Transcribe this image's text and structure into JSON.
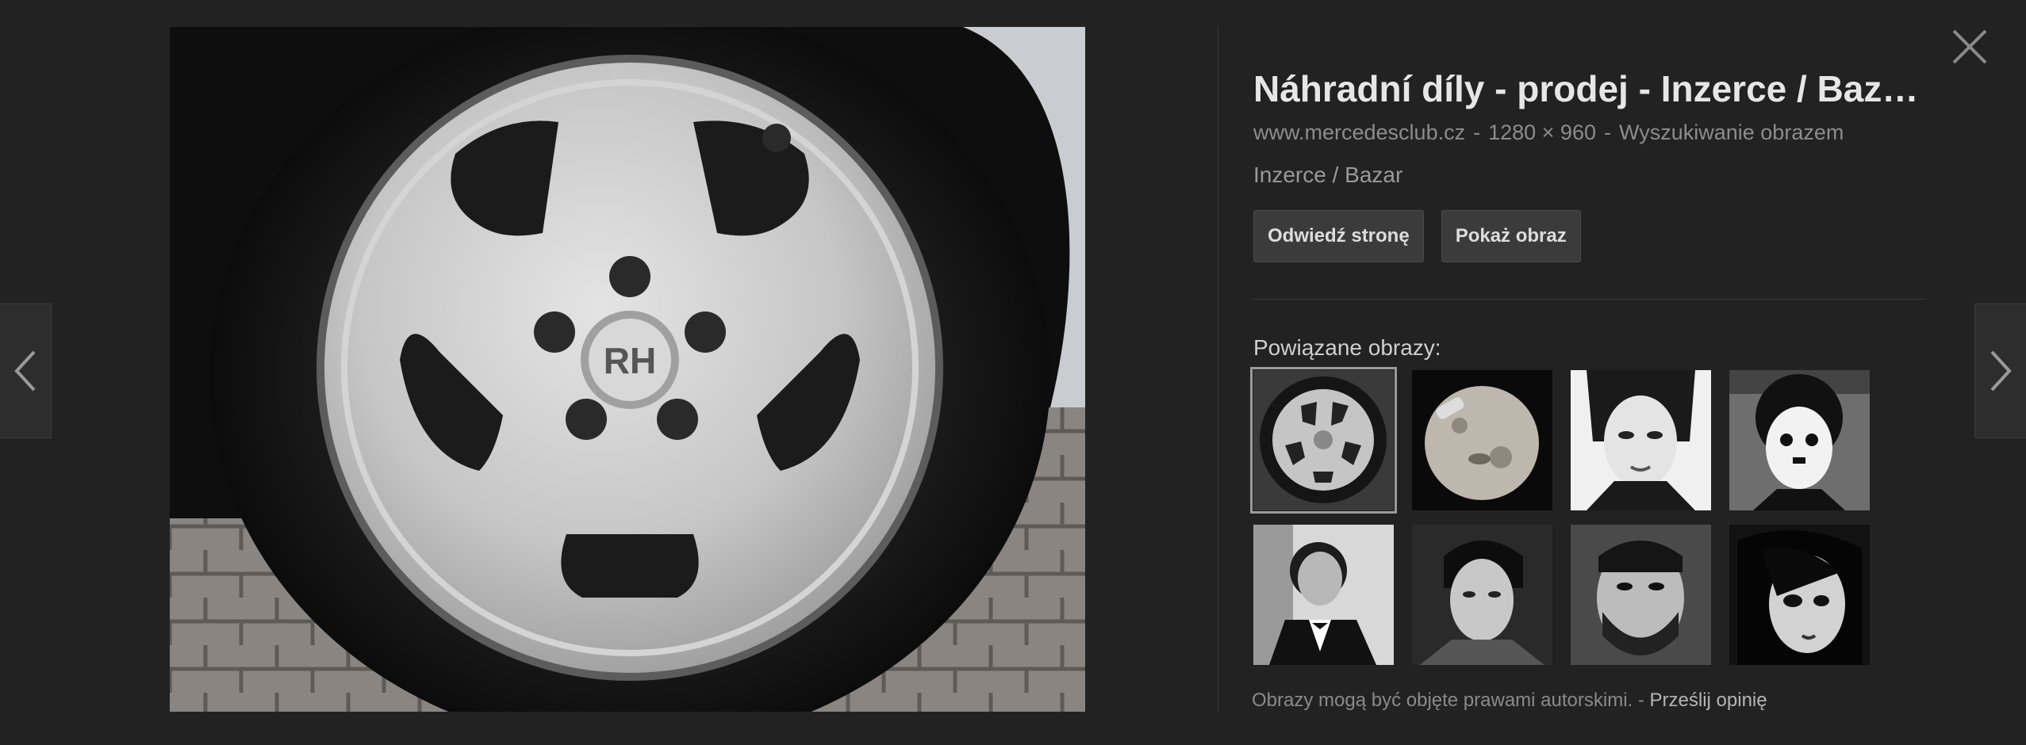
{
  "viewer": {
    "title": "Náhradní díly - prodej - Inzerce / Baz…",
    "source_domain": "www.mercedesclub.cz",
    "dimensions": "1280 × 960",
    "search_by_image": "Wyszukiwanie obrazem",
    "separator": "-",
    "subtitle": "Inzerce / Bazar",
    "visit_button": "Odwiedź stronę",
    "view_button": "Pokaż obraz",
    "related_label": "Powiązane obrazy:",
    "footer_text": "Obrazy mogą być objęte prawami autorskimi.",
    "footer_sep": "-",
    "feedback_link": "Prześlij opinię",
    "hub_badge": "RH"
  },
  "related_images": [
    {
      "name": "related-thumb-wheel",
      "selected": true
    },
    {
      "name": "related-thumb-moon",
      "selected": false
    },
    {
      "name": "related-thumb-woman-portrait",
      "selected": false
    },
    {
      "name": "related-thumb-clown-portrait",
      "selected": false
    },
    {
      "name": "related-thumb-man-tuxedo",
      "selected": false
    },
    {
      "name": "related-thumb-young-man",
      "selected": false
    },
    {
      "name": "related-thumb-bearded-man",
      "selected": false
    },
    {
      "name": "related-thumb-goth-girl",
      "selected": false
    }
  ],
  "icons": {
    "prev": "chevron-left-icon",
    "next": "chevron-right-icon",
    "close": "close-icon"
  },
  "colors": {
    "background": "#222222",
    "accent_text": "#e6e6e6",
    "muted_text": "#8c8c8c"
  }
}
